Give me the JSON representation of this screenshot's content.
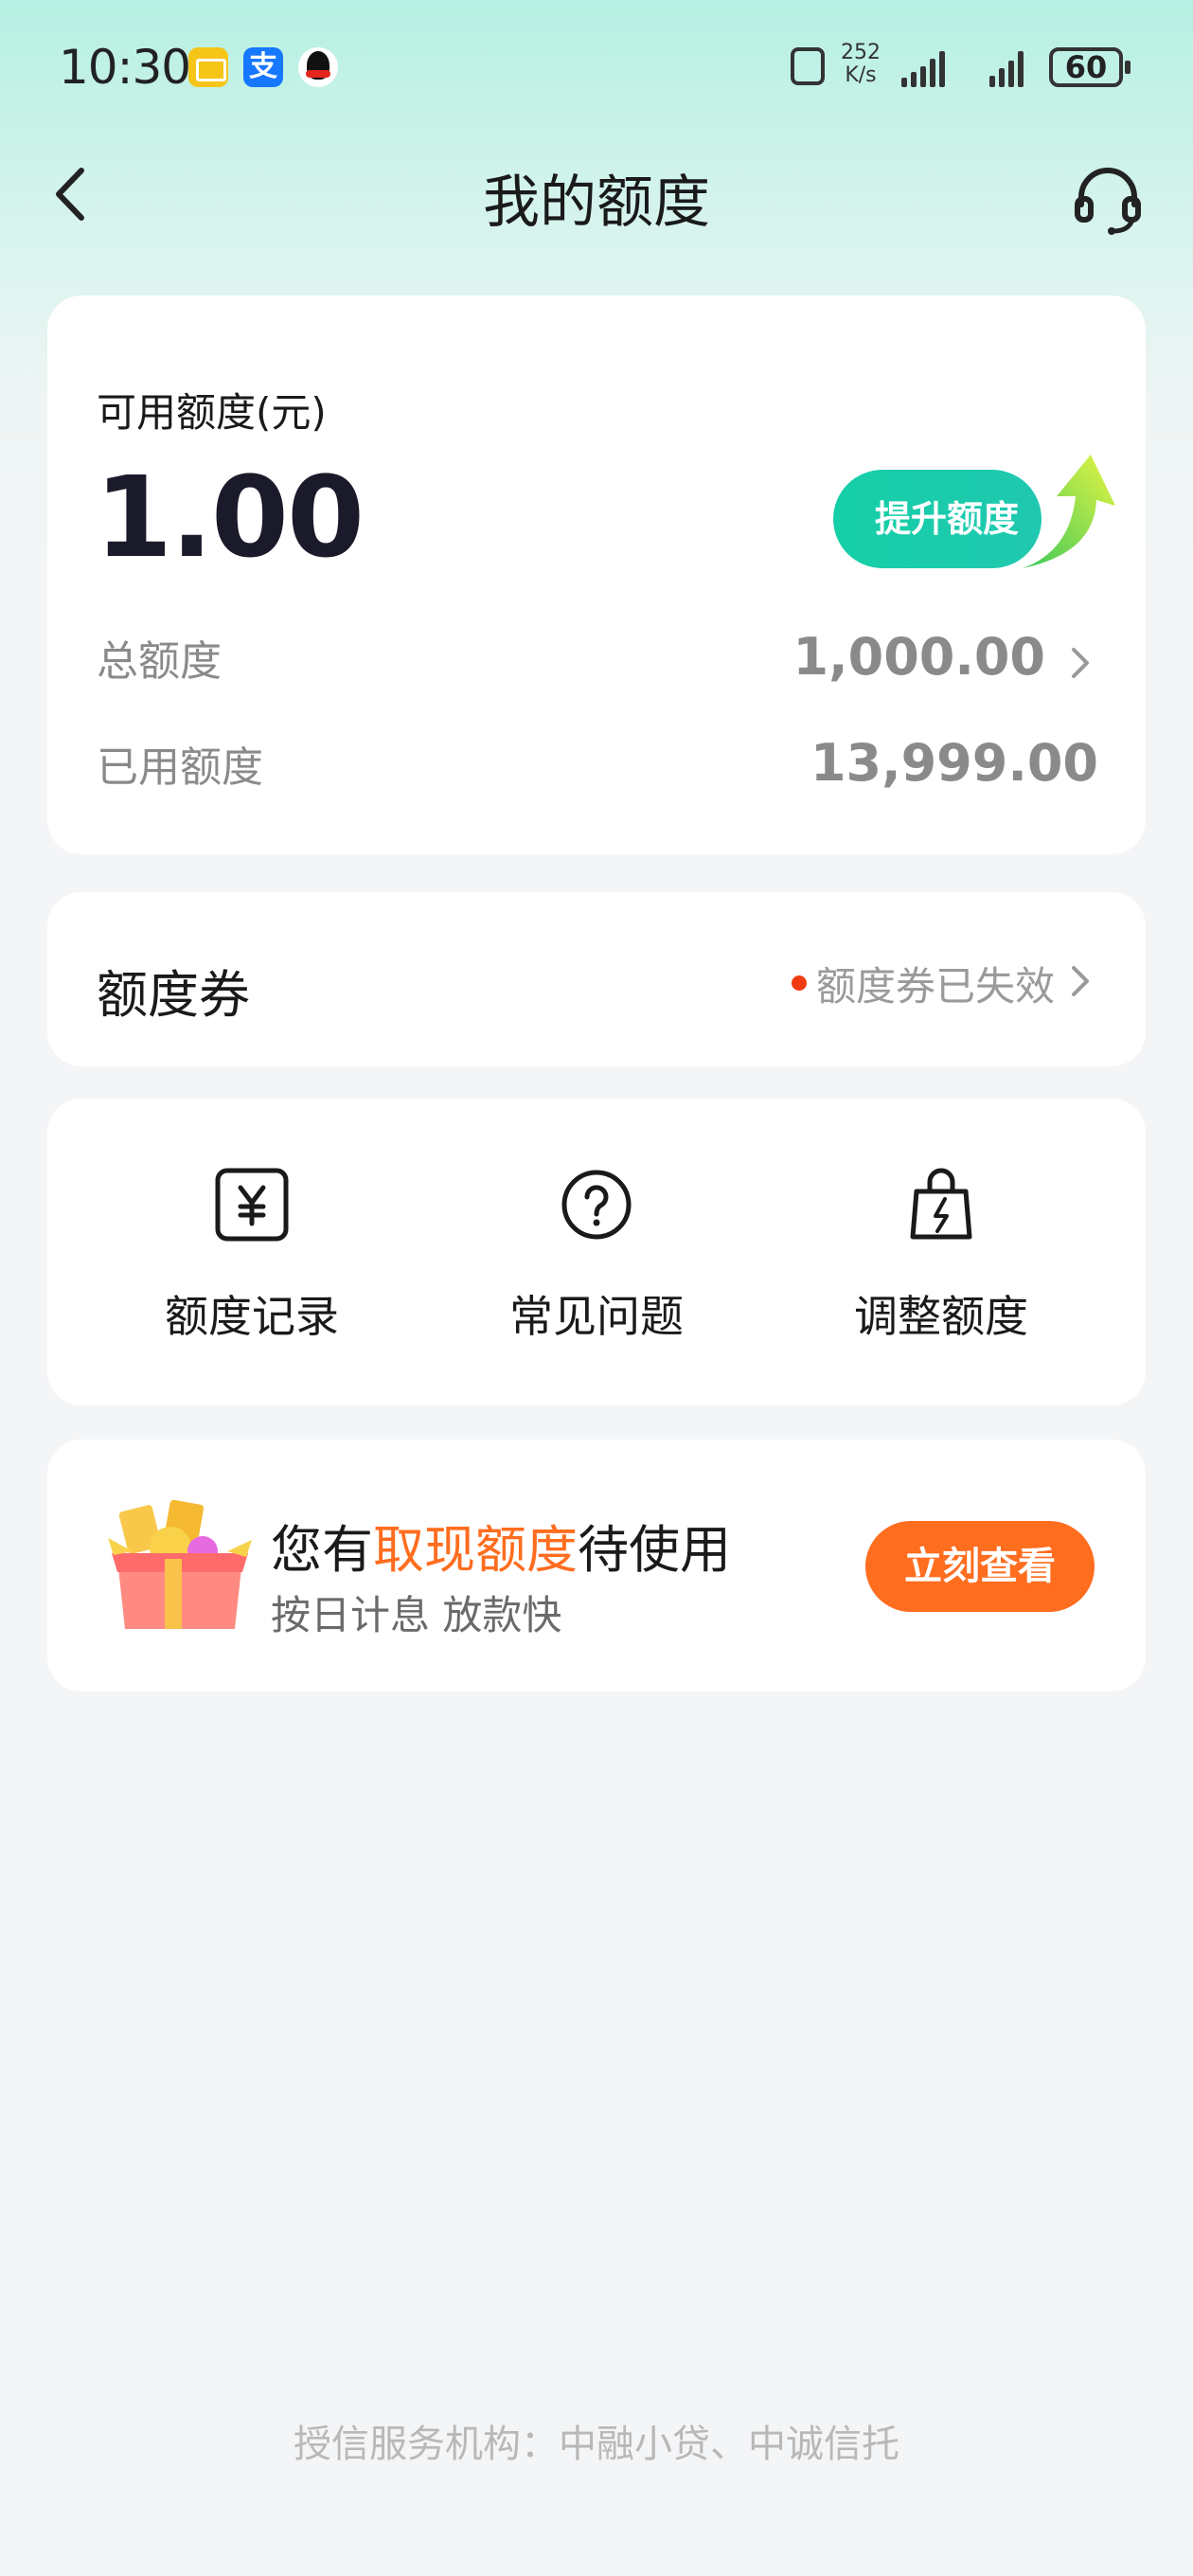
{
  "status_bar": {
    "time": "10:30",
    "net_speed_value": "252",
    "net_speed_unit": "K/s",
    "battery": "60",
    "app_icons": [
      "mail-icon",
      "alipay-icon",
      "qq-icon"
    ],
    "alipay_glyph": "支"
  },
  "nav": {
    "title": "我的额度"
  },
  "quota": {
    "available_label": "可用额度(元)",
    "available_value": "1.00",
    "upgrade_label": "提升额度",
    "total_label": "总额度",
    "total_value": "1,000.00",
    "used_label": "已用额度",
    "used_value": "13,999.00"
  },
  "coupon": {
    "title": "额度券",
    "status": "额度券已失效"
  },
  "actions": [
    {
      "label": "额度记录",
      "icon": "yuan-record-icon"
    },
    {
      "label": "常见问题",
      "icon": "question-icon"
    },
    {
      "label": "调整额度",
      "icon": "bag-lightning-icon"
    }
  ],
  "promo": {
    "title_prefix": "您有",
    "title_highlight": "取现额度",
    "title_suffix": "待使用",
    "subtitle": "按日计息 放款快",
    "button_label": "立刻查看"
  },
  "footer": {
    "text": "授信服务机构：中融小贷、中诚信托"
  },
  "colors": {
    "accent_green": "#15cfa7",
    "accent_orange": "#ff6d1f",
    "status_dot": "#f03b12"
  }
}
